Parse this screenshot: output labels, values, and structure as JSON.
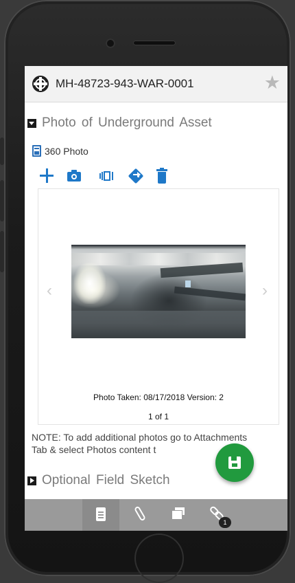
{
  "header": {
    "title": "MH-48723-943-WAR-0001"
  },
  "sections": {
    "photo": {
      "title": "Photo of Underground Asset"
    },
    "sketch": {
      "title": "Optional Field Sketch"
    }
  },
  "photo_field": {
    "label": "360 Photo"
  },
  "toolbar": {
    "icons": [
      "add-icon",
      "camera-icon",
      "panorama-icon",
      "directions-icon",
      "trash-icon"
    ]
  },
  "carousel": {
    "prev": "‹",
    "next": "›",
    "caption": "Photo Taken: 08/17/2018 Version: 2",
    "pager": "1 of 1"
  },
  "note": "NOTE: To add additional photos go to Attachments Tab & select Photos content t",
  "tabbar": {
    "tabs": [
      "document-icon",
      "paperclip-icon",
      "cards-icon",
      "link-icon"
    ],
    "link_badge": "1"
  },
  "colors": {
    "accent": "#1e78c8",
    "fab": "#219a3e",
    "tabbar": "#9a9a9a"
  }
}
